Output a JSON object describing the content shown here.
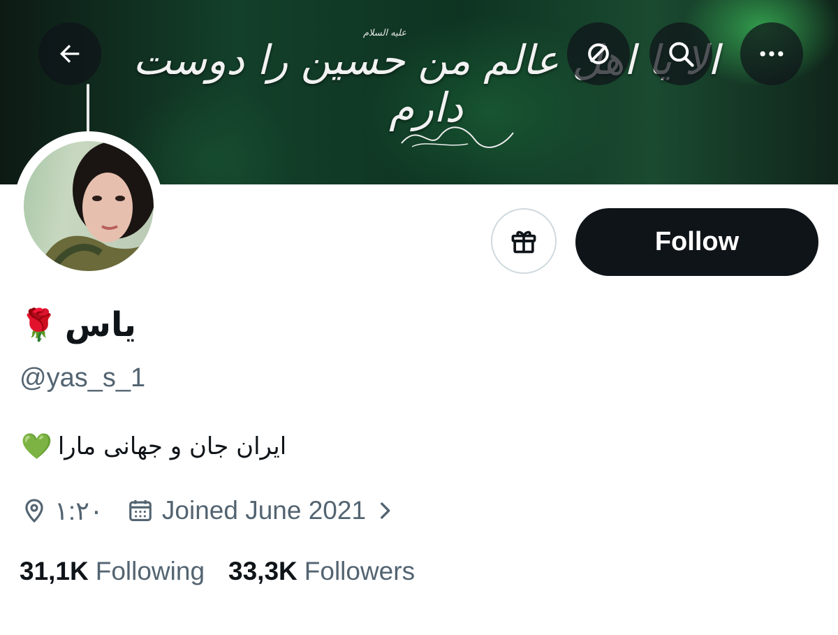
{
  "banner": {
    "calligraphy": "الا یا اهل عالم من حسین را دوست دارم",
    "small_text": "علیه السلام"
  },
  "toolbar": {
    "back_icon": "arrow-left-icon",
    "search_icon": "search-icon",
    "more_icon": "more-horizontal-icon"
  },
  "profile": {
    "display_name": "یاس",
    "name_emoji": "🌹",
    "handle": "@yas_s_1",
    "bio": "ایران جان و جهانی مارا",
    "bio_emoji": "💚",
    "location": "۱:۲۰",
    "joined": "Joined June 2021",
    "follow_label": "Follow",
    "gift_icon": "gift-icon"
  },
  "stats": {
    "following_count": "31,1K",
    "following_label": "Following",
    "followers_count": "33,3K",
    "followers_label": "Followers"
  },
  "colors": {
    "primary_text": "#0f1419",
    "secondary_text": "#536471",
    "follow_bg": "#0f1419",
    "border": "#cfd9de"
  }
}
